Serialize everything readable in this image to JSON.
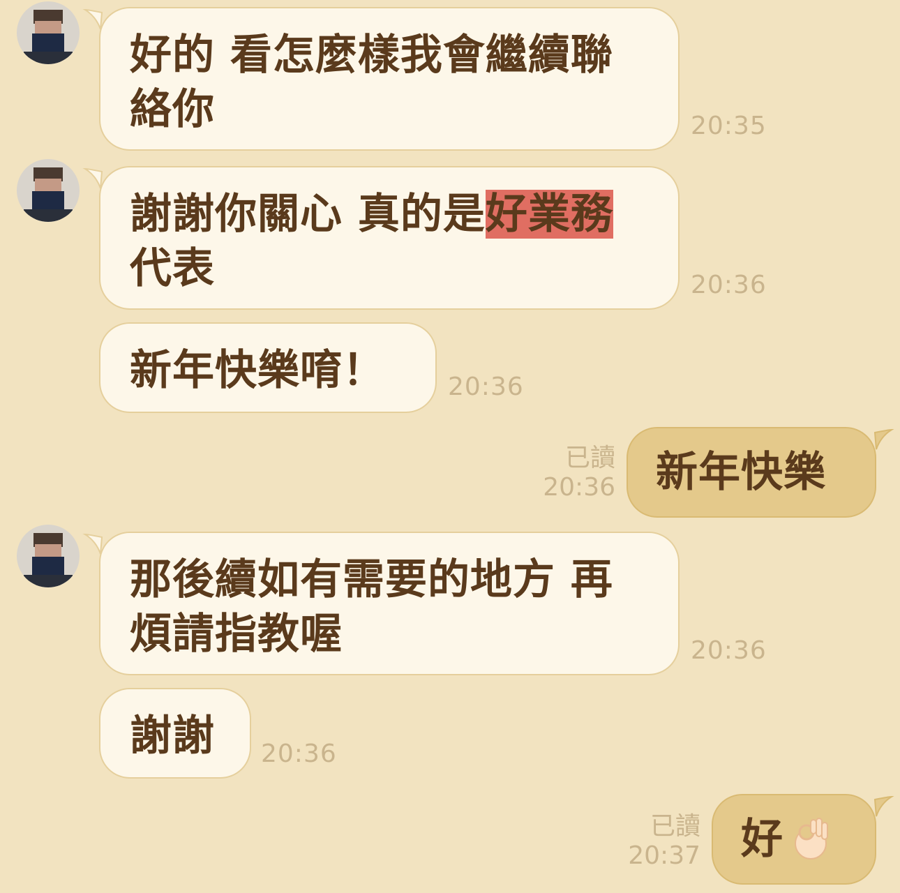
{
  "messages": [
    {
      "side": "in",
      "text_line1": "好的 看怎麼樣我會繼續聯",
      "text_line2": "絡你",
      "time": "20:35"
    },
    {
      "side": "in",
      "text_line1_pre": "謝謝你關心 真的是",
      "text_line1_hl": "好業務",
      "text_line2": "代表",
      "time": "20:36"
    },
    {
      "side": "in",
      "text": "新年快樂唷！",
      "time": "20:36"
    },
    {
      "side": "out",
      "text": "新年快樂",
      "read": "已讀",
      "time": "20:36"
    },
    {
      "side": "in",
      "text_line1": "那後續如有需要的地方 再",
      "text_line2": "煩請指教喔",
      "time": "20:36"
    },
    {
      "side": "in",
      "text": "謝謝",
      "time": "20:36"
    },
    {
      "side": "out",
      "text": "好",
      "emoji": "ok-hand-icon",
      "read": "已讀",
      "time": "20:37"
    }
  ],
  "colors": {
    "background": "#f2e3c0",
    "incoming_bubble": "#fdf7e9",
    "outgoing_bubble": "#e4c98b",
    "text": "#5a3a1c",
    "timestamp": "#c9b48d",
    "highlight": "#e06e62"
  }
}
